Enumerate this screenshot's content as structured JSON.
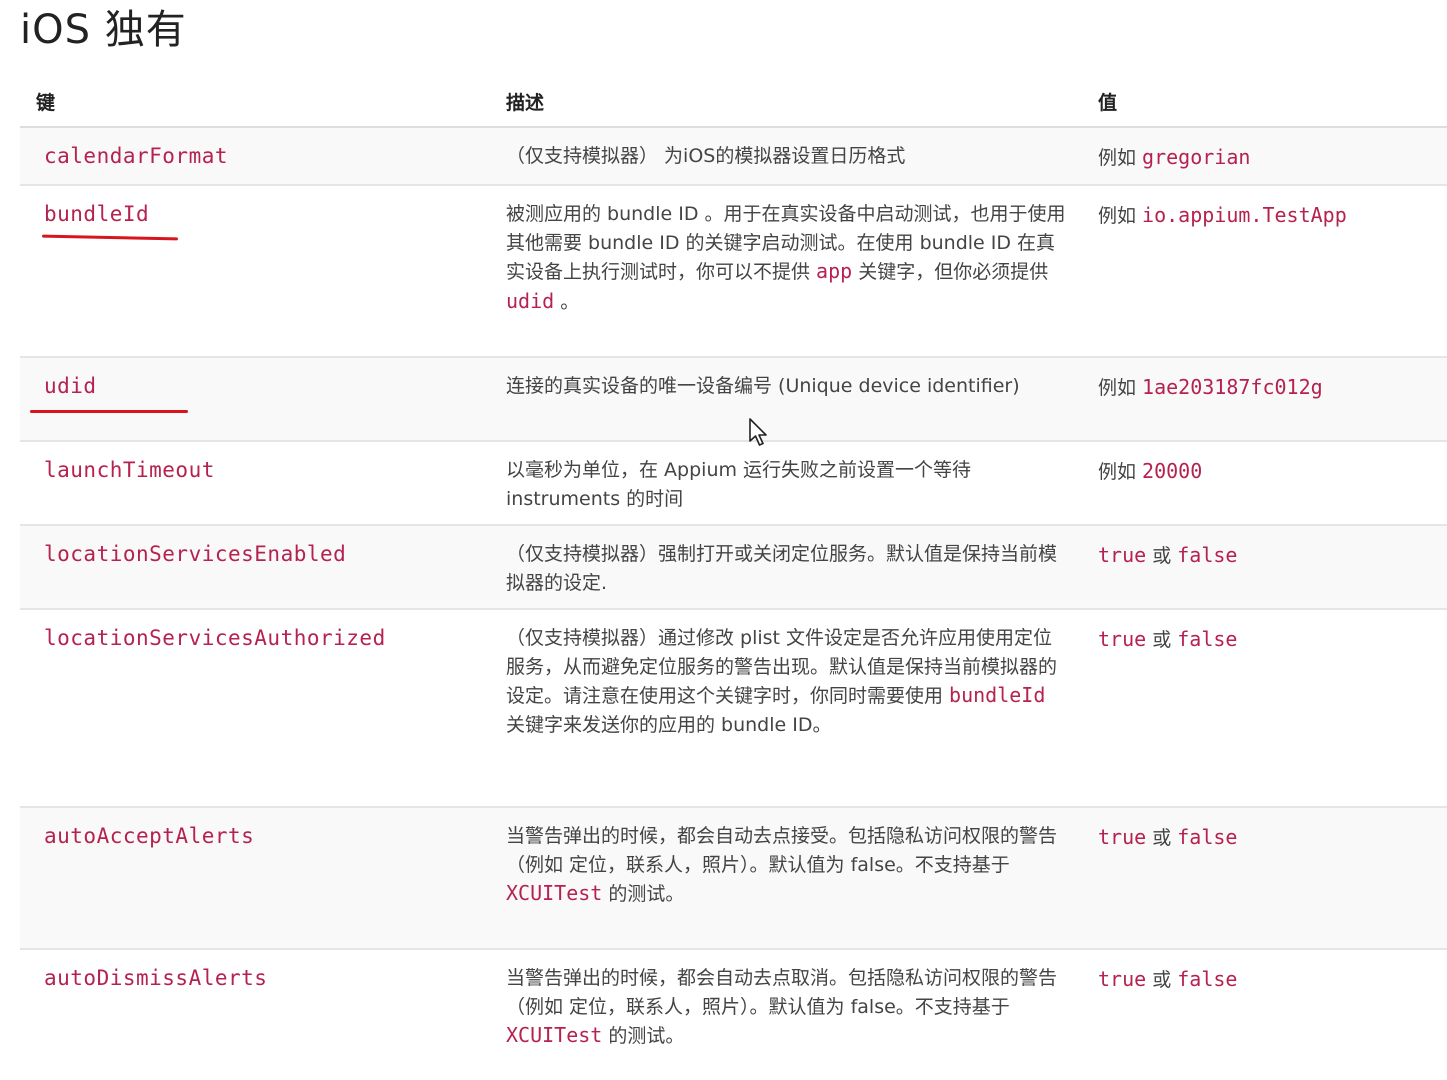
{
  "title": "iOS 独有",
  "headers": {
    "key": "键",
    "desc": "描述",
    "val": "值"
  },
  "rows": [
    {
      "key": "calendarFormat",
      "desc": [
        {
          "t": "（仅支持模拟器） 为iOS的模拟器设置日历格式"
        }
      ],
      "val": [
        {
          "t": "例如 "
        },
        {
          "t": "gregorian",
          "code": true
        }
      ]
    },
    {
      "key": "bundleId",
      "desc": [
        {
          "t": "被测应用的 bundle ID 。用于在真实设备中启动测试，也用于使用其他需要 bundle ID 的关键字启动测试。在使用 bundle ID 在真实设备上执行测试时，你可以不提供 "
        },
        {
          "t": "app",
          "code": true
        },
        {
          "t": " 关键字，但你必须提供 "
        },
        {
          "t": "udid",
          "code": true
        },
        {
          "t": " 。"
        }
      ],
      "val": [
        {
          "t": "例如 "
        },
        {
          "t": "io.appium.TestApp",
          "code": true
        }
      ]
    },
    {
      "key": "udid",
      "desc": [
        {
          "t": "连接的真实设备的唯一设备编号 (Unique device identifier)"
        }
      ],
      "val": [
        {
          "t": "例如 "
        },
        {
          "t": "1ae203187fc012g",
          "code": true
        }
      ]
    },
    {
      "key": "launchTimeout",
      "desc": [
        {
          "t": "以毫秒为单位，在 Appium 运行失败之前设置一个等待 instruments 的时间"
        }
      ],
      "val": [
        {
          "t": "例如 "
        },
        {
          "t": "20000",
          "code": true
        }
      ]
    },
    {
      "key": "locationServicesEnabled",
      "desc": [
        {
          "t": "（仅支持模拟器）强制打开或关闭定位服务。默认值是保持当前模拟器的设定."
        }
      ],
      "val": [
        {
          "t": "true",
          "code": true
        },
        {
          "t": " 或 "
        },
        {
          "t": "false",
          "code": true
        }
      ]
    },
    {
      "key": "locationServicesAuthorized",
      "desc": [
        {
          "t": "（仅支持模拟器）通过修改 plist 文件设定是否允许应用使用定位服务，从而避免定位服务的警告出现。默认值是保持当前模拟器的设定。请注意在使用这个关键字时，你同时需要使用 "
        },
        {
          "t": "bundleId",
          "code": true
        },
        {
          "t": " 关键字来发送你的应用的 bundle ID。"
        }
      ],
      "val": [
        {
          "t": "true",
          "code": true
        },
        {
          "t": " 或 "
        },
        {
          "t": "false",
          "code": true
        }
      ]
    },
    {
      "key": "autoAcceptAlerts",
      "desc": [
        {
          "t": "当警告弹出的时候，都会自动去点接受。包括隐私访问权限的警告（例如 定位，联系人，照片）。默认值为 false。不支持基于 "
        },
        {
          "t": "XCUITest",
          "code": true
        },
        {
          "t": " 的测试。"
        }
      ],
      "val": [
        {
          "t": "true",
          "code": true
        },
        {
          "t": " 或 "
        },
        {
          "t": "false",
          "code": true
        }
      ]
    },
    {
      "key": "autoDismissAlerts",
      "desc": [
        {
          "t": "当警告弹出的时候，都会自动去点取消。包括隐私访问权限的警告（例如 定位，联系人，照片）。默认值为 false。不支持基于 "
        },
        {
          "t": "XCUITest",
          "code": true
        },
        {
          "t": " 的测试。"
        }
      ],
      "val": [
        {
          "t": "true",
          "code": true
        },
        {
          "t": " 或 "
        },
        {
          "t": "false",
          "code": true
        }
      ]
    }
  ],
  "colors": {
    "code": "#b5224f",
    "annotation": "#d8141e",
    "row_alt": "#f9f9f9",
    "border": "#dddddd"
  }
}
